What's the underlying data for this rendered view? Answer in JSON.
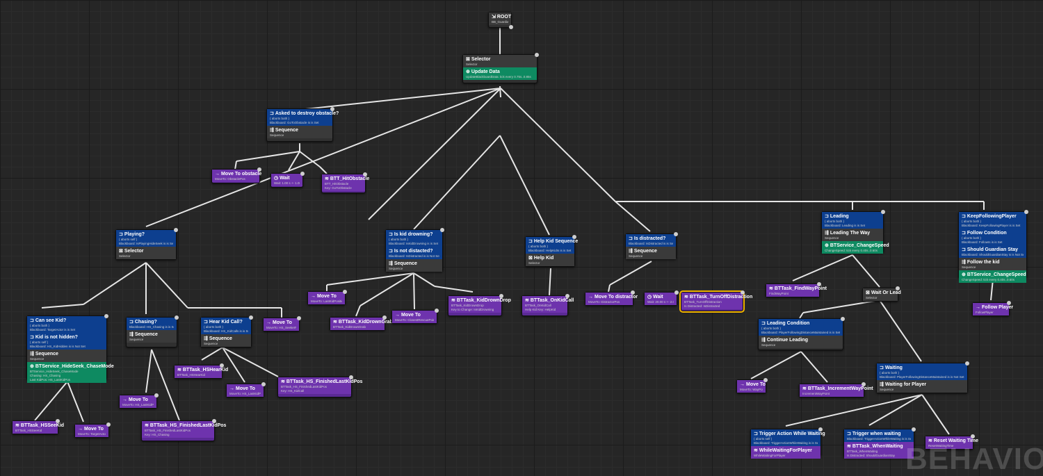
{
  "watermark": "BEHAVIO",
  "colors": {
    "background": "#262626",
    "decorator": "#0d3f8f",
    "composite": "#3a3a3a",
    "service": "#0e8a61",
    "task": "#5b2a95",
    "wire": "#e6e6e6",
    "selection": "#f2b400"
  },
  "nodes": {
    "root": {
      "title": "ROOT",
      "sub": "BB_Guardian"
    },
    "selector_main": {
      "title": "Selector",
      "sub": "Selector",
      "svc_title": "Update Data",
      "svc_sub": "UpdateBlackboardData: tick every 0.75s..0.85s"
    },
    "obstacle": {
      "deco_title": "Asked to destroy obstacle?",
      "deco_sub1": "( aborts both )",
      "deco_sub2": "Blackboard: GoToObstacle is is Set",
      "title": "Sequence",
      "sub": "Sequence"
    },
    "move_obstacle": {
      "title": "Move To obstacle",
      "sub": "MoveTo: ObstaclePos"
    },
    "wait_obstacle": {
      "title": "Wait",
      "sub": "Wait: 1.00 s +- 1.00 s"
    },
    "hit_obstacle": {
      "title": "BTT_HitObstacle",
      "sub": "BTT_HitObstacle",
      "sub2": "Key: GoToObstacle"
    },
    "playing": {
      "deco_title": "Playing?",
      "deco_sub1": "( aborts self )",
      "deco_sub2": "Blackboard: IsPlayingHideSeek is is Set",
      "title": "Selector",
      "sub": "Selector"
    },
    "can_see": {
      "deco_title": "Can see Kid?",
      "deco_sub1": "( aborts both )",
      "deco_sub2": "Blackboard: TargetActor is is Set",
      "deco2_title": "Kid is not hidden?",
      "deco2_sub1": "( aborts self )",
      "deco2_sub2": "Blackboard: HS_KidHidden is is Not Set",
      "title": "Sequence",
      "sub": "Sequence",
      "svc_title": "BTService_HideSeek_ChaseMode",
      "svc_sub": "BTService_HideSeek_ChaseMode",
      "svc_sub2": "Chasing: HS_Chasing",
      "svc_sub3": "Last KidPos: HS_LastKidPos"
    },
    "hs_see_kid": {
      "title": "BTTask_HSSeeKid",
      "sub": "BTTask_HSSeeKid"
    },
    "move_target": {
      "title": "Move To",
      "sub": "MoveTo: TargetActor"
    },
    "chasing": {
      "deco_title": "Chasing?",
      "deco_sub1": "Blackboard: HS_Chasing is is Set",
      "title": "Sequence",
      "sub": "Sequence"
    },
    "move_last_kid": {
      "title": "Move To",
      "sub": "MoveTo: HS_LastKidPos"
    },
    "hs_finished_1": {
      "title": "BTTask_HS_FinishedLastKidPos",
      "sub": "BTTask_HS_FinishedLastKidPos",
      "sub2": "Key: HS_Chasing"
    },
    "hear_kid": {
      "deco_title": "Hear Kid Call?",
      "deco_sub1": "( aborts both )",
      "deco_sub2": "Blackboard: HS_KidCalls is is Set",
      "title": "Sequence",
      "sub": "Sequence"
    },
    "hs_hear_kid": {
      "title": "BTTask_HSHearKid",
      "sub": "BTTask_HSHearKid"
    },
    "move_last_kid2": {
      "title": "Move To",
      "sub": "MoveTo: HS_LastKidPos"
    },
    "hs_finished_2": {
      "title": "BTTask_HS_FinishedLastKidPos",
      "sub": "BTTask_HS_FinishedLastKidPos",
      "sub2": "Key: HS_KidCall"
    },
    "move_seeker": {
      "title": "Move To",
      "sub": "MoveTo: HS_SeekerPos"
    },
    "drowning": {
      "deco_title": "Is kid drowning?",
      "deco_sub1": "( aborts both )",
      "deco_sub2": "Blackboard: IsKidDrowning is is Set",
      "deco2_title": "Is not distacted?",
      "deco2_sub1": "Blackboard: IsDistracted is is Not Set",
      "title": "Sequence",
      "sub": "Sequence"
    },
    "move_last_kid_pos": {
      "title": "Move To",
      "sub": "MoveTo: LastKidPosition"
    },
    "kid_drown_grab": {
      "title": "BTTask_KidDrownGrab",
      "sub": "BTTask_KidDrownGrab"
    },
    "move_rescue": {
      "title": "Move To",
      "sub": "MoveTo: ClosestRescuePoint"
    },
    "kid_drown_drop": {
      "title": "BTTask_KidDrownDrop",
      "sub": "BTTask_KidDrownDrop",
      "sub2": "Key to Change: IsKidDrowning"
    },
    "help_kid": {
      "deco_title": "Help Kid Sequence",
      "deco_sub1": "( aborts both )",
      "deco_sub2": "Blackboard: HelpKidIs is is Set",
      "title": "Help Kid",
      "sub": "Selector"
    },
    "on_kid_call": {
      "title": "BTTask_OnKidCall",
      "sub": "BTTask_OnKidCall",
      "sub2": "Help Kid Key: HelpKid"
    },
    "distracted": {
      "deco_title": "Is distracted?",
      "deco_sub1": "Blackboard: IsDistracted is is Set",
      "title": "Sequence",
      "sub": "Sequence"
    },
    "move_distractor": {
      "title": "Move To distractor",
      "sub": "MoveTo: DistractorPos"
    },
    "wait_distract": {
      "title": "Wait",
      "sub": "Wait: 20.00 s +- 2.00 s"
    },
    "turn_off_distraction": {
      "title": "BTTask_TurnOffDistraction",
      "sub": "BTTask_TurnOffDistraction",
      "sub2": "Is Distracted: IsDistracted"
    },
    "leading": {
      "deco_title": "Leading",
      "deco_sub1": "( aborts both )",
      "deco_sub2": "Blackboard: Leading is is Set",
      "title": "Leading The Way",
      "sub": "Sequence",
      "svc_title": "BTService_ChangeSpeed",
      "svc_sub": "ChangeSpeed: tick every 0.40s..0.60s"
    },
    "find_waypoint": {
      "title": "BTTask_FindWayPoint",
      "sub": "FindWayPoint"
    },
    "wait_or_lead": {
      "title": "Wait Or Lead",
      "sub": "Selector"
    },
    "leading_condition": {
      "deco_title": "Leading Condition",
      "deco_sub1": "( aborts both )",
      "deco_sub2": "Blackboard: PlayerFollowingDistanceMaintained is is Set",
      "title": "Continue Leading",
      "sub": "Sequence"
    },
    "move_waypoint": {
      "title": "Move To",
      "sub": "MoveTo: WayPoint"
    },
    "increment_waypoint": {
      "title": "BTTask_IncrementWayPoint",
      "sub": "IncrementWayPoint"
    },
    "waiting": {
      "deco_title": "Waiting",
      "deco_sub1": "( aborts both )",
      "deco_sub2": "Blackboard: PlayerFollowingDistanceMaintained is is Not Set",
      "title": "Waiting for Player",
      "sub": "Sequence"
    },
    "trigger_while_waiting": {
      "deco_title": "Trigger Action While Waiting",
      "deco_sub1": "( aborts self )",
      "deco_sub2": "Blackboard: TriggerActionWhileWaiting is is Set",
      "title": "WhileWaitingForPlayer",
      "sub": "WhileWaitingForPlayer"
    },
    "trigger_when_waiting": {
      "deco_title": "Trigger when waiting",
      "deco_sub1": "Blackboard: TriggerActionWhileWaiting is is Set",
      "title": "BTTask_WhenWaiting",
      "sub": "BTTask_WhenWaiting",
      "sub2": "Is Distracted: ShouldGuardianStay"
    },
    "reset_waiting": {
      "title": "Reset Waiting Time",
      "sub": "ResetWaitingTime"
    },
    "keep_following": {
      "deco_title": "KeepFollowingPlayer",
      "deco_sub1": "( aborts both )",
      "deco_sub2": "Blackboard: KeepFollowingPlayer is is Set",
      "deco2_title": "Follow Condition",
      "deco2_sub1": "( aborts both )",
      "deco2_sub2": "Blackboard: FollowIs is is Set",
      "deco3_title": "Should Guardian Stay",
      "deco3_sub1": "Blackboard: ShouldGuardianStay is is Not Set",
      "title": "Follow the kid",
      "sub": "Sequence",
      "svc_title": "BTService_ChangeSpeed",
      "svc_sub": "ChangeSpeed: tick every 0.40s..0.60s"
    },
    "follow_player": {
      "title": "Follow Player",
      "sub": "FollowPlayer"
    }
  }
}
